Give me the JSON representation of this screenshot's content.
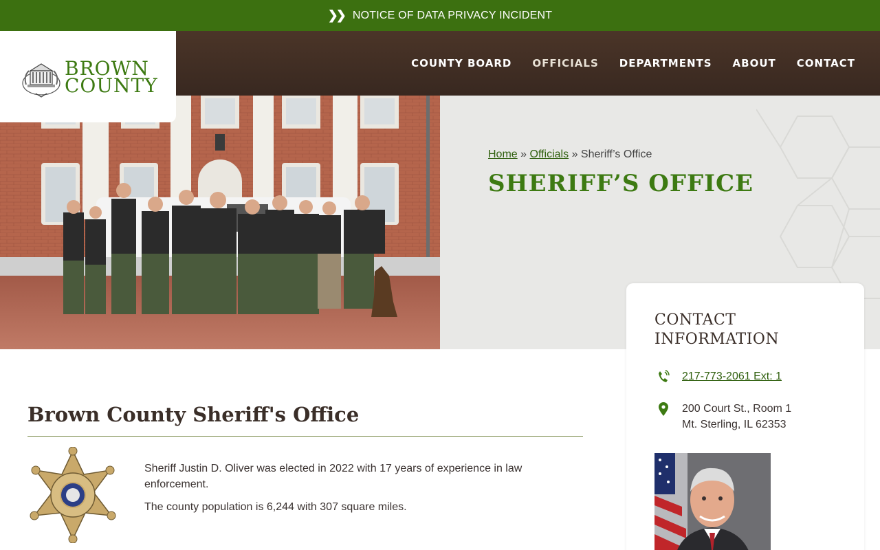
{
  "notice": {
    "text": "NOTICE OF DATA PRIVACY INCIDENT",
    "icon": "double-chevron-right-icon"
  },
  "logo": {
    "line1": "BROWN",
    "line2": "COUNTY"
  },
  "nav": {
    "items": [
      {
        "label": "COUNTY BOARD"
      },
      {
        "label": "OFFICIALS"
      },
      {
        "label": "DEPARTMENTS"
      },
      {
        "label": "ABOUT"
      },
      {
        "label": "CONTACT"
      }
    ]
  },
  "breadcrumb": {
    "home": "Home",
    "sep1": "»",
    "officials": "Officials",
    "sep2": "»",
    "current": "Sheriff’s Office"
  },
  "page_title": "SHERIFF’S OFFICE",
  "contact": {
    "heading_line1": "CONTACT",
    "heading_line2": "INFORMATION",
    "phone": "217-773-2061 Ext: 1",
    "address_line1": "200 Court St., Room 1",
    "address_line2": "Mt. Sterling, IL 62353"
  },
  "main": {
    "title": "Brown County Sheriff's Office",
    "paragraph1": "Sheriff Justin D. Oliver was elected in 2022 with 17 years of experience in law enforcement.",
    "paragraph2": "The county population is 6,244 with 307 square miles."
  },
  "colors": {
    "brand_green": "#3d7a12",
    "notice_green": "#3c7010",
    "header_brown": "#3e2c22"
  }
}
